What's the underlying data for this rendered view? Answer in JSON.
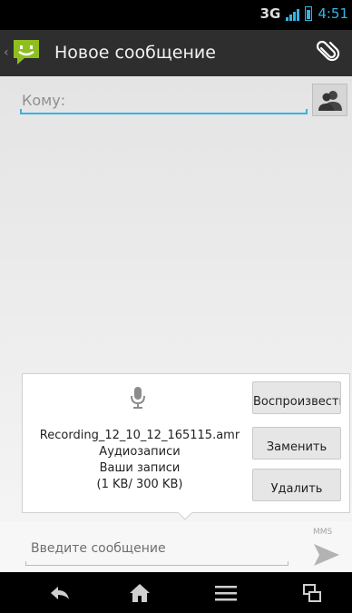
{
  "status_bar": {
    "network": "3G",
    "time": "4:51"
  },
  "action_bar": {
    "title": "Новое сообщение"
  },
  "recipient": {
    "placeholder": "Кому:"
  },
  "attachment": {
    "file_name": "Recording_12_10_12_165115.amr",
    "category": "Аудиозаписи",
    "collection": "Ваши записи",
    "size": "(1 KB/ 300 KB)",
    "buttons": {
      "play": "Воспроизвести",
      "replace": "Заменить",
      "delete": "Удалить"
    }
  },
  "compose": {
    "placeholder": "Введите сообщение",
    "mode_label": "MMS"
  },
  "colors": {
    "accent": "#33b5e5",
    "app_icon": "#8fbf1f"
  }
}
